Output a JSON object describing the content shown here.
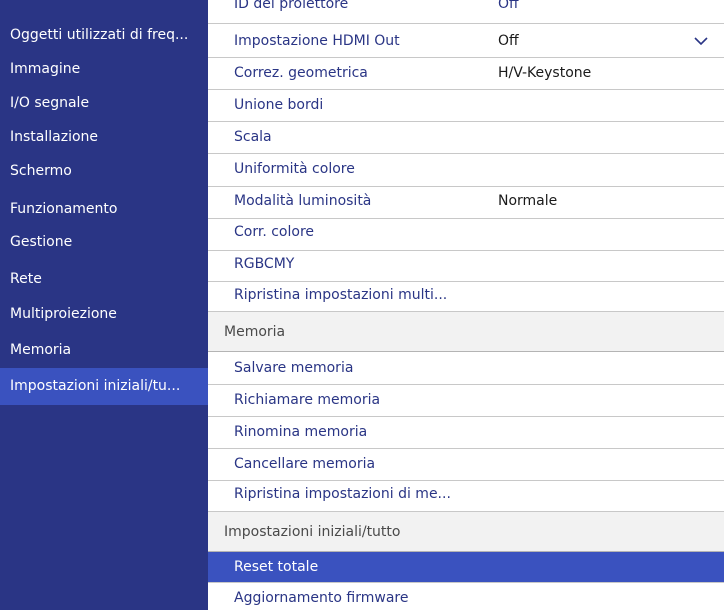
{
  "sidebar": {
    "items": [
      {
        "label": "Oggetti utilizzati di freq..."
      },
      {
        "label": "Immagine"
      },
      {
        "label": "I/O segnale"
      },
      {
        "label": "Installazione"
      },
      {
        "label": "Schermo"
      },
      {
        "label": "Funzionamento"
      },
      {
        "label": "Gestione"
      },
      {
        "label": "Rete"
      },
      {
        "label": "Multiproiezione"
      },
      {
        "label": "Memoria"
      },
      {
        "label": "Impostazioni iniziali/tu..."
      }
    ],
    "selected_index": 10
  },
  "panel": {
    "partial_row": {
      "label": "ID del proiettore",
      "value": "Off"
    },
    "rows": [
      {
        "label": "Impostazione HDMI Out",
        "value": "Off",
        "icon": "chevron-down-icon"
      },
      {
        "label": "Correz. geometrica",
        "value": "H/V-Keystone"
      },
      {
        "label": "Unione bordi"
      },
      {
        "label": "Scala"
      },
      {
        "label": "Uniformità colore"
      },
      {
        "label": "Modalità luminosità",
        "value": "Normale"
      },
      {
        "label": "Corr. colore"
      },
      {
        "label": "RGBCMY"
      },
      {
        "label": "Ripristina impostazioni multi..."
      }
    ],
    "memory_header": "Memoria",
    "memory_rows": [
      {
        "label": "Salvare memoria"
      },
      {
        "label": "Richiamare memoria"
      },
      {
        "label": "Rinomina memoria"
      },
      {
        "label": "Cancellare memoria"
      },
      {
        "label": "Ripristina impostazioni di me..."
      }
    ],
    "initial_header": "Impostazioni iniziali/tutto",
    "initial_rows": [
      {
        "label": "Reset totale",
        "selected": true
      },
      {
        "label": "Aggiornamento firmware"
      }
    ]
  },
  "colors": {
    "sidebar_bg": "#2a3585",
    "selection": "#3a52bf",
    "item_text": "#2a3585",
    "value_text": "#1a1a1a"
  }
}
